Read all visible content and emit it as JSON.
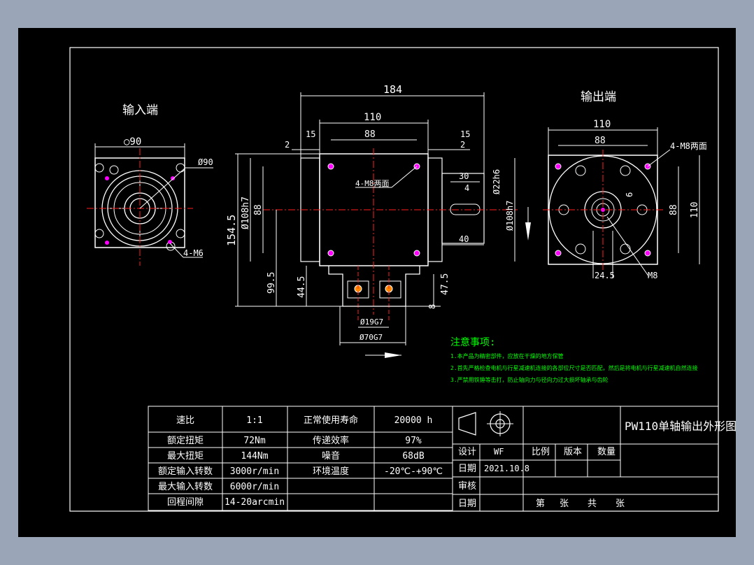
{
  "views": {
    "input_title": "输入端",
    "output_title": "输出端"
  },
  "dims": {
    "input_circ90": "○90",
    "input_phi90": "Ø90",
    "input_holes": "4-M6",
    "top_184": "184",
    "top_110": "110",
    "top_88": "88",
    "top_15a": "15",
    "top_2a": "2",
    "top_15b": "15",
    "top_2b": "2",
    "side_4m8": "4-M8两面",
    "side_30": "30",
    "side_4": "4",
    "side_phi22": "Ø22h6",
    "side_phi108b": "Ø108h7",
    "side_40": "40",
    "left_154": "154.5",
    "left_phi108": "Ø108h7",
    "left_88": "88",
    "bot_99": "99.5",
    "bot_44": "44.5",
    "bot_47": "47.5",
    "bot_8": "8",
    "bot_phi19": "Ø19G7",
    "bot_phi70": "Ø70G7",
    "out_110": "110",
    "out_88": "88",
    "out_4m8": "4-M8两面",
    "out_6": "6",
    "out_88v": "88",
    "out_110v": "110",
    "out_24": "24.5",
    "out_m8": "M8"
  },
  "notes": {
    "title": "注意事项:",
    "lines": [
      "1.本产品为精密部件，应放在干燥的地方保管",
      "2.首先严格检查电机与行星减速机连接的各部位尺寸是否匹配，然后是将电机与行星减速机自然连接",
      "3.严禁用铁锤等击打，防止轴向力与径向力过大损坏轴承与齿轮"
    ]
  },
  "spec_table": {
    "rows": [
      [
        "速比",
        "1:1",
        "正常使用寿命",
        "20000 h"
      ],
      [
        "额定扭矩",
        "72Nm",
        "传递效率",
        "97%"
      ],
      [
        "最大扭矩",
        "144Nm",
        "噪音",
        "68dB"
      ],
      [
        "额定输入转数",
        "3000r/min",
        "环境温度",
        "-20℃-+90℃"
      ],
      [
        "最大输入转数",
        "6000r/min",
        "",
        ""
      ],
      [
        "回程间隙",
        "14-20arcmin",
        "",
        ""
      ]
    ]
  },
  "title_block": {
    "drawing_title": "PW110单轴输出外形图",
    "design_label": "设计",
    "designer": "WF",
    "scale_label": "比例",
    "version_label": "版本",
    "qty_label": "数量",
    "date_label": "日期",
    "date_value": "2021.10.8",
    "review_label": "审核",
    "date2_label": "日期",
    "sheet_text": [
      "第",
      "张",
      "共",
      "张"
    ]
  },
  "colors": {
    "background": "#9aa6b8",
    "sheet": "#000000",
    "line": "#ffffff",
    "centerline": "#ff2020",
    "notes": "#00ff00",
    "hole_marker": "#ff00ff"
  }
}
